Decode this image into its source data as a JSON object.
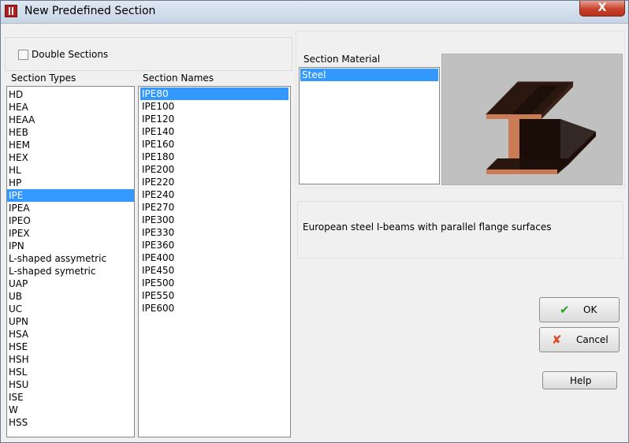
{
  "window": {
    "title": "New Predefined Section",
    "close_glyph": "X"
  },
  "double_sections": {
    "label": "Double Sections",
    "checked": false
  },
  "section_types": {
    "header": "Section Types",
    "items": [
      "HD",
      "HEA",
      "HEAA",
      "HEB",
      "HEM",
      "HEX",
      "HL",
      "HP",
      "IPE",
      "IPEA",
      "IPEO",
      "IPEX",
      "IPN",
      "L-shaped assymetric",
      "L-shaped symetric",
      "UAP",
      "UB",
      "UC",
      "UPN",
      "HSA",
      "HSE",
      "HSH",
      "HSL",
      "HSU",
      "ISE",
      "W",
      "HSS"
    ],
    "selected": "IPE"
  },
  "section_names": {
    "header": "Section Names",
    "items": [
      "IPE80",
      "IPE100",
      "IPE120",
      "IPE140",
      "IPE160",
      "IPE180",
      "IPE200",
      "IPE220",
      "IPE240",
      "IPE270",
      "IPE300",
      "IPE330",
      "IPE360",
      "IPE400",
      "IPE450",
      "IPE500",
      "IPE550",
      "IPE600"
    ],
    "selected": "IPE80"
  },
  "section_material": {
    "header": "Section Material",
    "items": [
      "Steel"
    ],
    "selected": "Steel"
  },
  "preview": {
    "icon": "i-beam-3d-preview"
  },
  "description": "European steel I-beams with parallel flange surfaces",
  "buttons": {
    "ok": {
      "label": "OK",
      "icon": "checkmark-icon",
      "icon_color": "#2e9e2e"
    },
    "cancel": {
      "label": "Cancel",
      "icon": "cross-icon",
      "icon_color": "#e0451e"
    },
    "help": {
      "label": "Help"
    }
  },
  "colors": {
    "selection": "#3399ff",
    "beam": "#2a1810",
    "beam_edge": "#c77a55"
  }
}
